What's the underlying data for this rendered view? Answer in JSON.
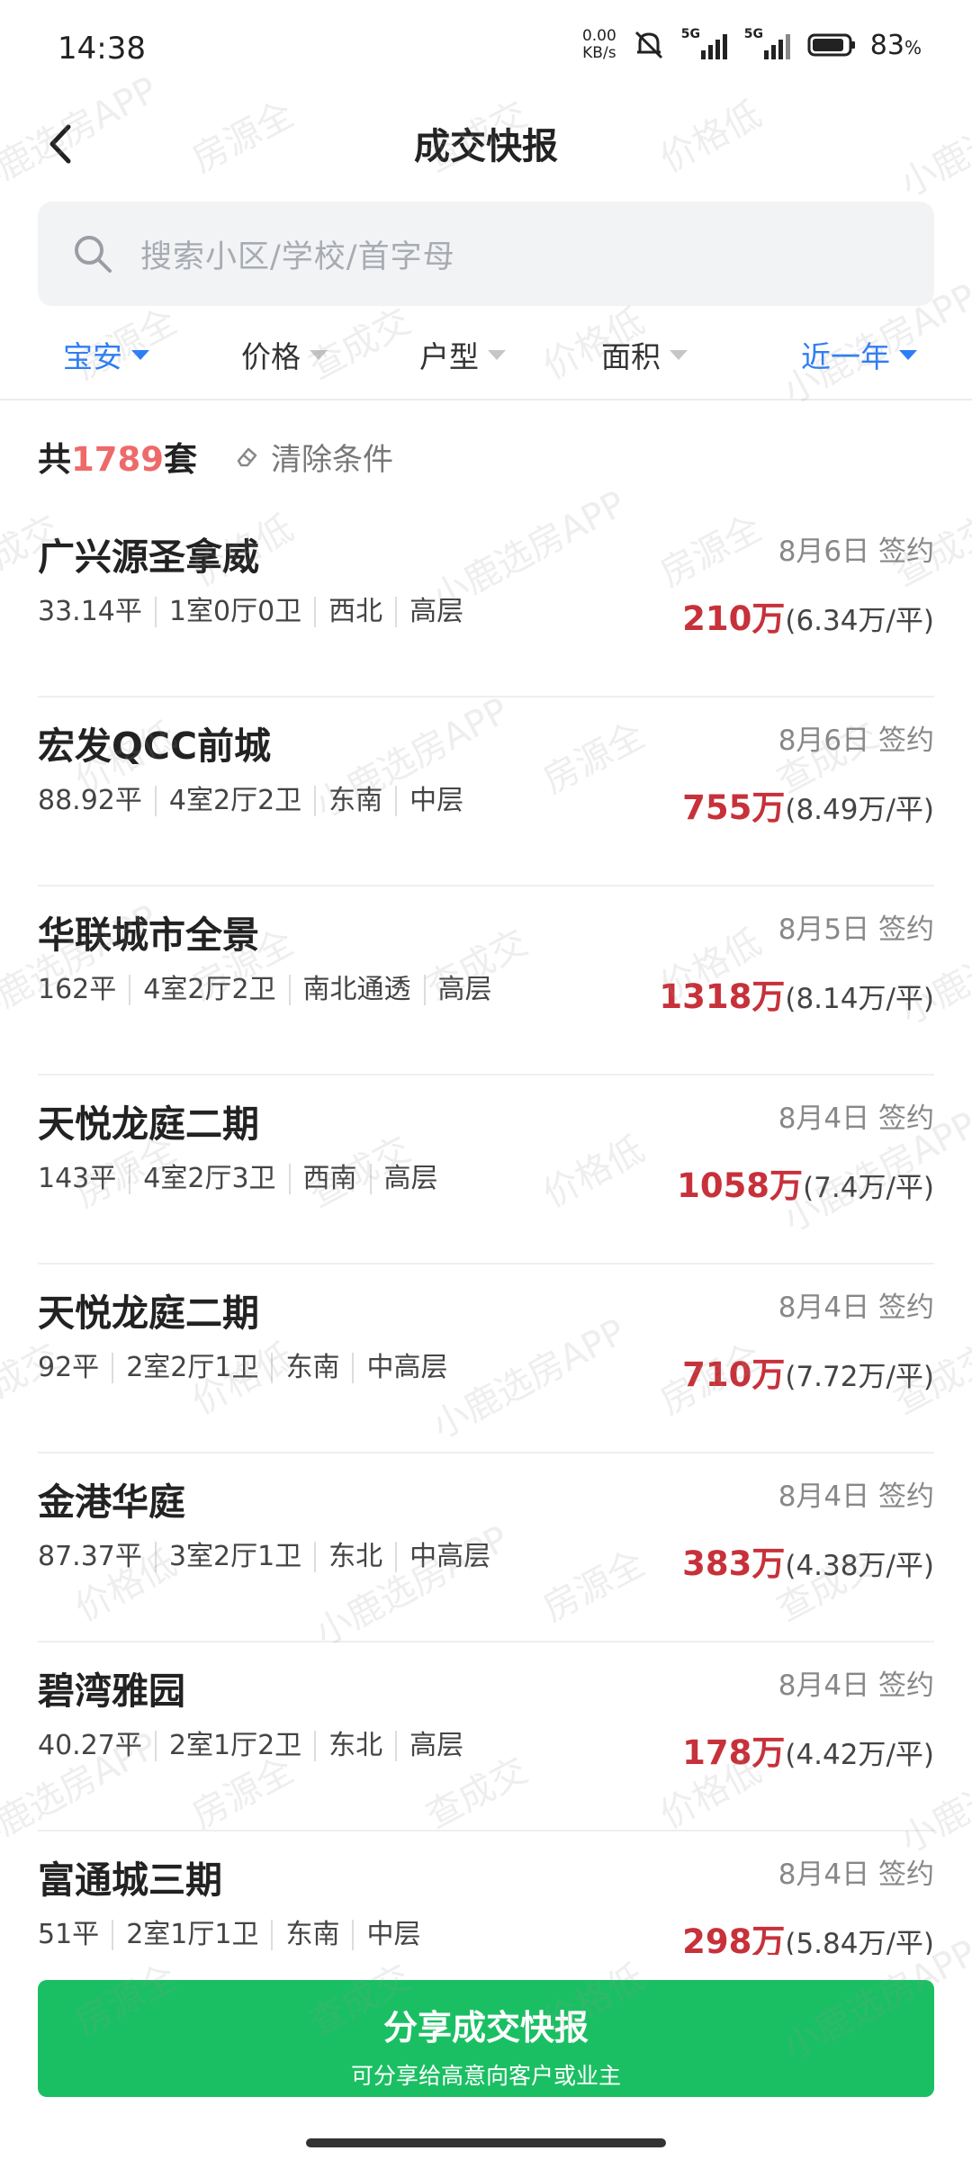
{
  "status_bar": {
    "time": "14:38",
    "net_speed_value": "0.00",
    "net_speed_unit": "KB/s",
    "sim1": "5G",
    "sim2": "5G",
    "battery_percent": "83",
    "battery_symbol": "%"
  },
  "header": {
    "title": "成交快报",
    "back_icon": "chevron-left-icon"
  },
  "search": {
    "placeholder": "搜索小区/学校/首字母"
  },
  "filters": {
    "district": "宝安",
    "price": "价格",
    "layout": "户型",
    "area": "面积",
    "period": "近一年",
    "active_color": "#2d7df6"
  },
  "summary": {
    "prefix": "共",
    "count": "1789",
    "suffix": "套",
    "clear_label": "清除条件"
  },
  "listings": [
    {
      "name": "广兴源圣拿威",
      "date": "8月6日 签约",
      "area": "33.14平",
      "rooms": "1室0厅0卫",
      "orientation": "西北",
      "floor": "高层",
      "total": "210万",
      "unit": "(6.34万/平)"
    },
    {
      "name": "宏发QCC前城",
      "date": "8月6日 签约",
      "area": "88.92平",
      "rooms": "4室2厅2卫",
      "orientation": "东南",
      "floor": "中层",
      "total": "755万",
      "unit": "(8.49万/平)"
    },
    {
      "name": "华联城市全景",
      "date": "8月5日 签约",
      "area": "162平",
      "rooms": "4室2厅2卫",
      "orientation": "南北通透",
      "floor": "高层",
      "total": "1318万",
      "unit": "(8.14万/平)"
    },
    {
      "name": "天悦龙庭二期",
      "date": "8月4日 签约",
      "area": "143平",
      "rooms": "4室2厅3卫",
      "orientation": "西南",
      "floor": "高层",
      "total": "1058万",
      "unit": "(7.4万/平)"
    },
    {
      "name": "天悦龙庭二期",
      "date": "8月4日 签约",
      "area": "92平",
      "rooms": "2室2厅1卫",
      "orientation": "东南",
      "floor": "中高层",
      "total": "710万",
      "unit": "(7.72万/平)"
    },
    {
      "name": "金港华庭",
      "date": "8月4日 签约",
      "area": "87.37平",
      "rooms": "3室2厅1卫",
      "orientation": "东北",
      "floor": "中高层",
      "total": "383万",
      "unit": "(4.38万/平)"
    },
    {
      "name": "碧湾雅园",
      "date": "8月4日 签约",
      "area": "40.27平",
      "rooms": "2室1厅2卫",
      "orientation": "东北",
      "floor": "高层",
      "total": "178万",
      "unit": "(4.42万/平)"
    },
    {
      "name": "富通城三期",
      "date": "8月4日 签约",
      "area": "51平",
      "rooms": "2室1厅1卫",
      "orientation": "东南",
      "floor": "中层",
      "total": "298万",
      "unit": "(5.84万/平)"
    }
  ],
  "share": {
    "title": "分享成交快报",
    "subtitle": "可分享给高意向客户或业主",
    "color": "#1bbf63"
  },
  "watermark": {
    "phrases": [
      "小鹿选房APP",
      "房源全",
      "查成交",
      "价格低"
    ]
  },
  "colors": {
    "price_red": "#c7313a",
    "count_red": "#ee6a6a"
  }
}
